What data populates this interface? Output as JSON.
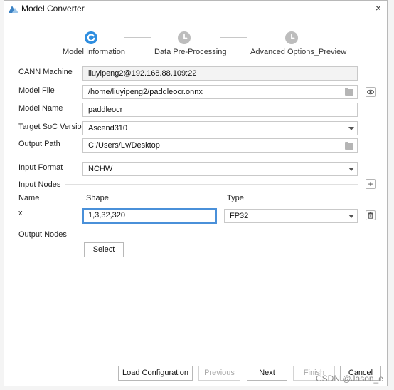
{
  "window": {
    "title": "Model Converter",
    "close_symbol": "×"
  },
  "steps": [
    {
      "label": "Model Information",
      "state": "active"
    },
    {
      "label": "Data Pre-Processing",
      "state": "pending"
    },
    {
      "label": "Advanced Options_Preview",
      "state": "pending"
    }
  ],
  "form": {
    "cann_machine": {
      "label": "CANN Machine",
      "value": "liuyipeng2@192.168.88.109:22"
    },
    "model_file": {
      "label": "Model File",
      "value": "/home/liuyipeng2/paddleocr.onnx"
    },
    "model_name": {
      "label": "Model Name",
      "value": "paddleocr"
    },
    "target_soc": {
      "label": "Target SoC Version",
      "value": "Ascend310"
    },
    "output_path": {
      "label": "Output Path",
      "value": "C:/Users/Lv/Desktop"
    },
    "input_format": {
      "label": "Input Format",
      "value": "NCHW"
    },
    "input_nodes": {
      "label": "Input Nodes",
      "add_symbol": "+",
      "headers": {
        "name": "Name",
        "shape": "Shape",
        "type": "Type"
      },
      "rows": [
        {
          "name": "x",
          "shape": "1,3,32,320",
          "type": "FP32"
        }
      ]
    },
    "output_nodes": {
      "label": "Output Nodes",
      "select_label": "Select"
    }
  },
  "footer": {
    "load_config": "Load Configuration",
    "previous": "Previous",
    "next": "Next",
    "finish": "Finish",
    "cancel": "Cancel"
  },
  "colors": {
    "accent": "#2f8ee0",
    "pending": "#bdbdbd",
    "focus": "#4a90d9"
  },
  "watermark": "CSDN @Jason_e"
}
